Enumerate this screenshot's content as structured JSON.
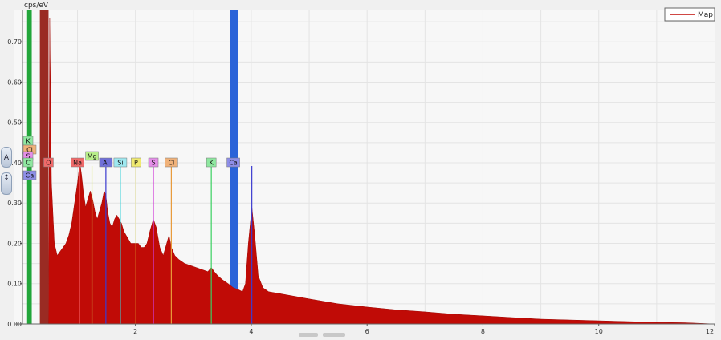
{
  "toolbar": {
    "label_mode_button": "A",
    "arrows_glyph": "↕",
    "zoom_icon": "vertical-arrows-icon"
  },
  "colors": {
    "spectrum": "#c00b06",
    "background": "#f7f7f7",
    "grid": "#e4e4e4",
    "ca_band": "#2a63d8",
    "c_band": "#22a63a",
    "o_band": "#9a2b23"
  },
  "chart_data": {
    "type": "area",
    "title": "",
    "ylabel": "cps/eV",
    "xlabel": "",
    "xlim": [
      0.05,
      12.0
    ],
    "ylim": [
      0.0,
      0.78
    ],
    "x_ticks": [
      "2",
      "4",
      "6",
      "8",
      "10",
      "12"
    ],
    "x_tick_values": [
      2,
      4,
      6,
      8,
      10,
      12
    ],
    "y_ticks": [
      "0.00",
      "0.10",
      "0.20",
      "0.30",
      "0.40",
      "0.50",
      "0.60",
      "0.70"
    ],
    "y_tick_values": [
      0.0,
      0.1,
      0.2,
      0.3,
      0.4,
      0.5,
      0.6,
      0.7
    ],
    "grid": true,
    "legend": {
      "position": "top-right",
      "entries": [
        "Map"
      ]
    },
    "series": [
      {
        "name": "Map",
        "x": [
          0.05,
          0.5,
          0.52,
          0.55,
          0.6,
          0.65,
          0.7,
          0.75,
          0.8,
          0.85,
          0.9,
          0.95,
          1.0,
          1.04,
          1.07,
          1.1,
          1.14,
          1.18,
          1.22,
          1.26,
          1.3,
          1.34,
          1.38,
          1.42,
          1.46,
          1.49,
          1.52,
          1.56,
          1.6,
          1.64,
          1.68,
          1.72,
          1.76,
          1.8,
          1.84,
          1.88,
          1.92,
          1.96,
          2.0,
          2.05,
          2.1,
          2.15,
          2.2,
          2.25,
          2.31,
          2.36,
          2.42,
          2.48,
          2.54,
          2.58,
          2.62,
          2.68,
          2.75,
          2.85,
          2.95,
          3.05,
          3.15,
          3.25,
          3.31,
          3.36,
          3.42,
          3.5,
          3.6,
          3.69,
          3.78,
          3.85,
          3.9,
          3.95,
          4.01,
          4.06,
          4.12,
          4.2,
          4.3,
          4.5,
          5.0,
          5.5,
          6.0,
          6.5,
          7.0,
          7.5,
          8.0,
          8.5,
          9.0,
          9.5,
          10.0,
          10.5,
          11.0,
          11.5,
          12.0
        ],
        "y": [
          0.0,
          0.0,
          0.76,
          0.35,
          0.2,
          0.17,
          0.18,
          0.19,
          0.2,
          0.22,
          0.25,
          0.3,
          0.35,
          0.4,
          0.37,
          0.33,
          0.29,
          0.31,
          0.33,
          0.31,
          0.28,
          0.26,
          0.28,
          0.3,
          0.33,
          0.32,
          0.28,
          0.25,
          0.24,
          0.26,
          0.27,
          0.26,
          0.25,
          0.23,
          0.22,
          0.21,
          0.2,
          0.2,
          0.2,
          0.2,
          0.19,
          0.19,
          0.2,
          0.23,
          0.26,
          0.24,
          0.19,
          0.17,
          0.2,
          0.22,
          0.19,
          0.17,
          0.16,
          0.15,
          0.145,
          0.14,
          0.135,
          0.13,
          0.14,
          0.13,
          0.12,
          0.11,
          0.1,
          0.09,
          0.085,
          0.08,
          0.1,
          0.2,
          0.29,
          0.22,
          0.12,
          0.09,
          0.08,
          0.075,
          0.062,
          0.05,
          0.042,
          0.035,
          0.03,
          0.024,
          0.02,
          0.016,
          0.012,
          0.01,
          0.008,
          0.006,
          0.004,
          0.003,
          0.0
        ]
      }
    ],
    "element_bands": [
      {
        "element": "C",
        "x": [
          0.13,
          0.21
        ],
        "color": "#22a63a"
      },
      {
        "element": "O",
        "x": [
          0.35,
          0.5
        ],
        "color": "#9a2b23"
      },
      {
        "element": "Ca",
        "x": [
          3.64,
          3.77
        ],
        "color": "#2a63d8"
      }
    ],
    "element_markers": [
      {
        "label": "K",
        "x": 0.1,
        "color": "#8fe8a0",
        "row": 0
      },
      {
        "label": "Cl",
        "x": 0.05,
        "color": "#f0b27a",
        "row": 1
      },
      {
        "label": "S",
        "x": 0.03,
        "color": "#e48ee8",
        "row": 2
      },
      {
        "label": "C",
        "x": 0.1,
        "color": "#8fe8a0",
        "row": 3
      },
      {
        "label": "O",
        "x": 0.5,
        "color": "#f06a6a",
        "row": 3
      },
      {
        "label": "Ca",
        "x": 0.1,
        "color": "#8e8ee8",
        "row": 4
      },
      {
        "label": "Na",
        "x": 1.0,
        "color": "#f06a6a",
        "row": 3
      },
      {
        "label": "Mg",
        "x": 1.25,
        "color": "#b8ee8a",
        "row": 2
      },
      {
        "label": "Al",
        "x": 1.49,
        "color": "#7070d8",
        "row": 3
      },
      {
        "label": "Si",
        "x": 1.74,
        "color": "#9ee8f0",
        "row": 3
      },
      {
        "label": "P",
        "x": 2.01,
        "color": "#f0ea70",
        "row": 3
      },
      {
        "label": "S",
        "x": 2.31,
        "color": "#e48ee8",
        "row": 3
      },
      {
        "label": "Cl",
        "x": 2.62,
        "color": "#f0b27a",
        "row": 3
      },
      {
        "label": "K",
        "x": 3.31,
        "color": "#8fe8a0",
        "row": 3
      },
      {
        "label": "Ca",
        "x": 3.69,
        "color": "#8e8ee8",
        "row": 3
      }
    ],
    "marker_lines": [
      {
        "x": 1.04,
        "color": "#e03c3c"
      },
      {
        "x": 1.25,
        "color": "#d9e85a"
      },
      {
        "x": 1.49,
        "color": "#3b3bd0"
      },
      {
        "x": 1.74,
        "color": "#3ad0d8"
      },
      {
        "x": 2.01,
        "color": "#e8e23a"
      },
      {
        "x": 2.31,
        "color": "#d03ad8"
      },
      {
        "x": 2.62,
        "color": "#e89a3a"
      },
      {
        "x": 3.31,
        "color": "#3ad060"
      },
      {
        "x": 4.01,
        "color": "#3b3bd0"
      }
    ]
  }
}
